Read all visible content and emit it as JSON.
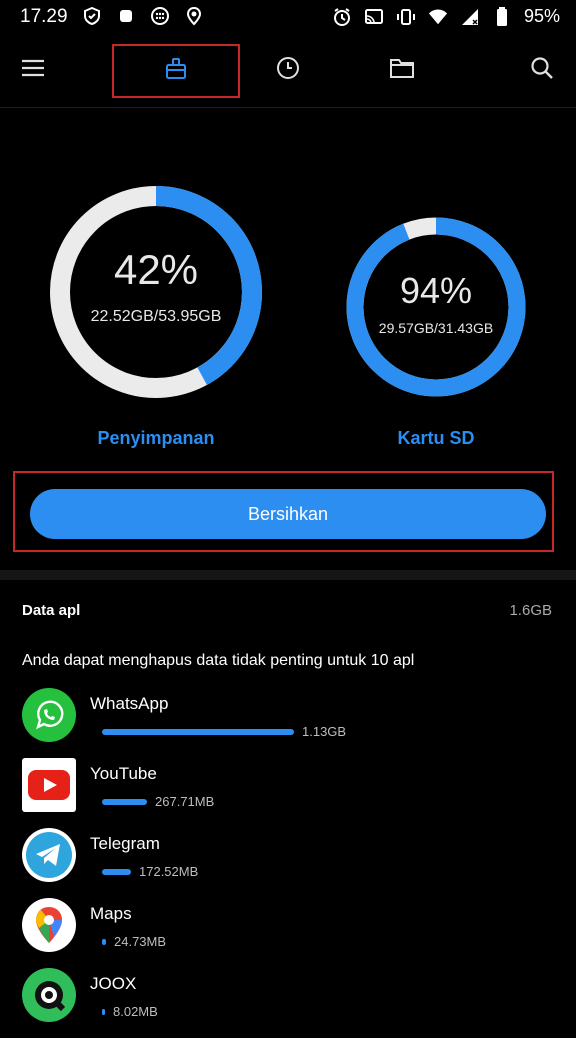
{
  "status_bar": {
    "time": "17.29",
    "battery": "95%"
  },
  "storage": {
    "internal": {
      "percent": "42%",
      "used_total": "22.52GB/53.95GB",
      "label": "Penyimpanan",
      "fraction": 0.42
    },
    "sd": {
      "percent": "94%",
      "used_total": "29.57GB/31.43GB",
      "label": "Kartu SD",
      "fraction": 0.94
    }
  },
  "clean_button": "Bersihkan",
  "app_data": {
    "title": "Data apl",
    "total": "1.6GB",
    "description": "Anda dapat menghapus data tidak penting untuk 10 apl",
    "apps": [
      {
        "name": "WhatsApp",
        "size": "1.13GB",
        "fraction": 1.0
      },
      {
        "name": "YouTube",
        "size": "267.71MB",
        "fraction": 0.236
      },
      {
        "name": "Telegram",
        "size": "172.52MB",
        "fraction": 0.152
      },
      {
        "name": "Maps",
        "size": "24.73MB",
        "fraction": 0.022
      },
      {
        "name": "JOOX",
        "size": "8.02MB",
        "fraction": 0.007
      }
    ]
  },
  "colors": {
    "accent": "#2b8ef0",
    "ring_track": "#ebebeb",
    "highlight": "#c62828"
  }
}
